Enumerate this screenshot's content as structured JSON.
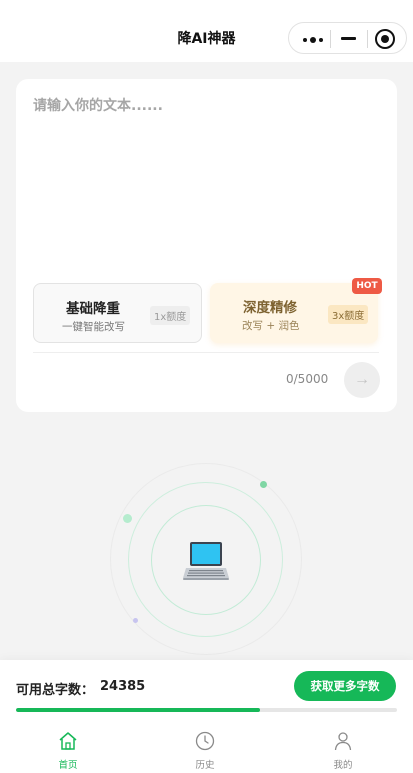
{
  "app": {
    "title": "降AI神器"
  },
  "editor": {
    "placeholder": "请输入你的文本......",
    "counter": "0/5000"
  },
  "modes": {
    "basic": {
      "name": "基础降重",
      "sub": "一键智能改写",
      "quota": "1x额度"
    },
    "deep": {
      "name": "深度精修",
      "sub": "改写 + 润色",
      "quota": "3x额度",
      "badge": "HOT"
    }
  },
  "submit": {
    "icon": "arrow-right-icon"
  },
  "wallet": {
    "label": "可用总字数：",
    "value": "24385",
    "button": "获取更多字数",
    "progress_percent": 64
  },
  "tabs": [
    {
      "label": "首页",
      "icon": "home-icon",
      "active": true
    },
    {
      "label": "历史",
      "icon": "clock-icon",
      "active": false
    },
    {
      "label": "我的",
      "icon": "user-icon",
      "active": false
    }
  ],
  "colors": {
    "accent": "#16b858",
    "hot": "#ee5a45",
    "deep_bg": "#fff6e6",
    "background": "#f3f3f3"
  }
}
